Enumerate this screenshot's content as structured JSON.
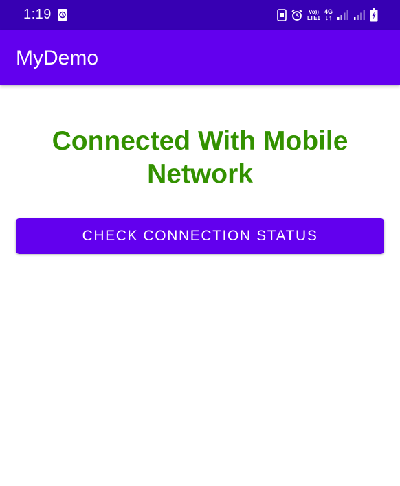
{
  "status_bar": {
    "time": "1:19",
    "volte_top": "Vo))",
    "volte_bottom": "LTE1",
    "network_type": "4G",
    "network_arrows": "↓↑",
    "background_color": "#3700b3",
    "icons": [
      "notification-icon",
      "screenshot-icon",
      "alarm-icon",
      "volte-icon",
      "network-4g-icon",
      "signal-sim1-icon",
      "signal-sim2-icon",
      "battery-charging-icon"
    ]
  },
  "app_bar": {
    "title": "MyDemo",
    "background_color": "#6200ee"
  },
  "main": {
    "status_message": "Connected With Mobile Network",
    "status_color": "#339100",
    "check_button_label": "Check Connection Status"
  }
}
